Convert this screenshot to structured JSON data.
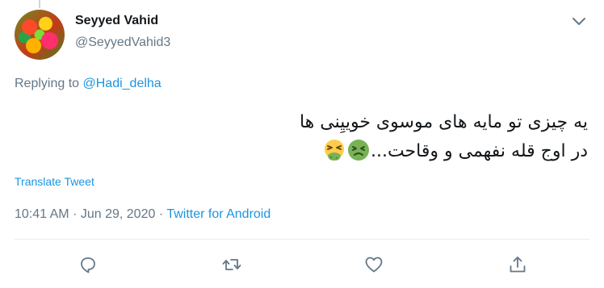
{
  "author": {
    "name": "Seyyed Vahid",
    "handle": "@SeyyedVahid3"
  },
  "reply": {
    "prefix": "Replying to",
    "handle": "@Hadi_delha"
  },
  "tweet": {
    "line1": "یه چیزی تو مایه های موسوی خوییِنی ها",
    "line2": "در اوج قله نفهمی و وقاحت..."
  },
  "emojis": [
    "nauseated-face",
    "tired-face"
  ],
  "translate_label": "Translate Tweet",
  "meta": {
    "time": "10:41 AM",
    "separator": "·",
    "date": "Jun 29, 2020",
    "source": "Twitter for Android"
  },
  "icons": {
    "menu": "chevron-down-icon",
    "reply": "reply-icon",
    "retweet": "retweet-icon",
    "like": "like-icon",
    "share": "share-icon"
  },
  "colors": {
    "link": "#1b95e0",
    "muted": "#657786",
    "text": "#14171a",
    "divider": "#e6ecf0"
  }
}
